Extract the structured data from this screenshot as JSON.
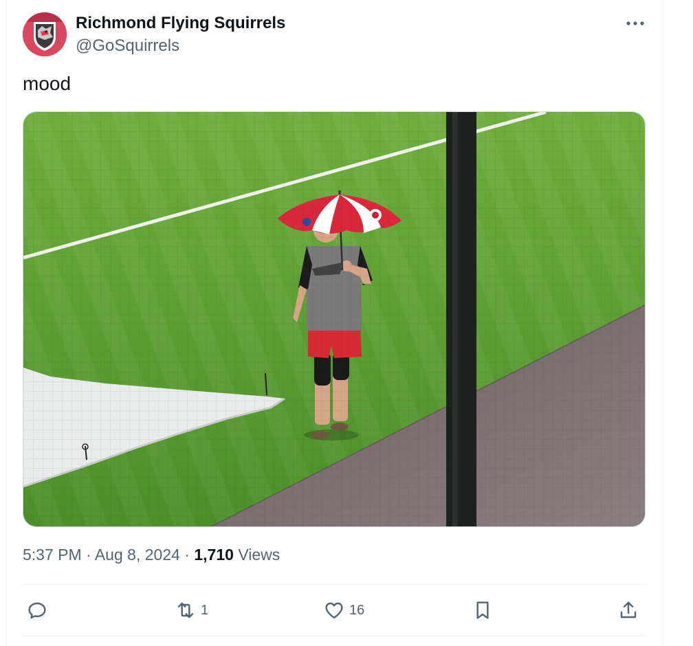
{
  "author": {
    "display_name": "Richmond Flying Squirrels",
    "handle": "@GoSquirrels"
  },
  "tweet": {
    "text": "mood",
    "time": "5:37 PM",
    "date": "Aug 8, 2024",
    "views_count": "1,710",
    "views_label": "Views",
    "separator": "·"
  },
  "actions": {
    "reply_count": "",
    "retweet_count": "1",
    "like_count": "16"
  },
  "icons": {
    "more": "more-horizontal-icon",
    "reply": "reply-icon",
    "retweet": "retweet-icon",
    "like": "heart-icon",
    "bookmark": "bookmark-icon",
    "share": "share-icon"
  },
  "colors": {
    "text_primary": "#0f1419",
    "text_secondary": "#536471",
    "border": "#eff3f4"
  }
}
